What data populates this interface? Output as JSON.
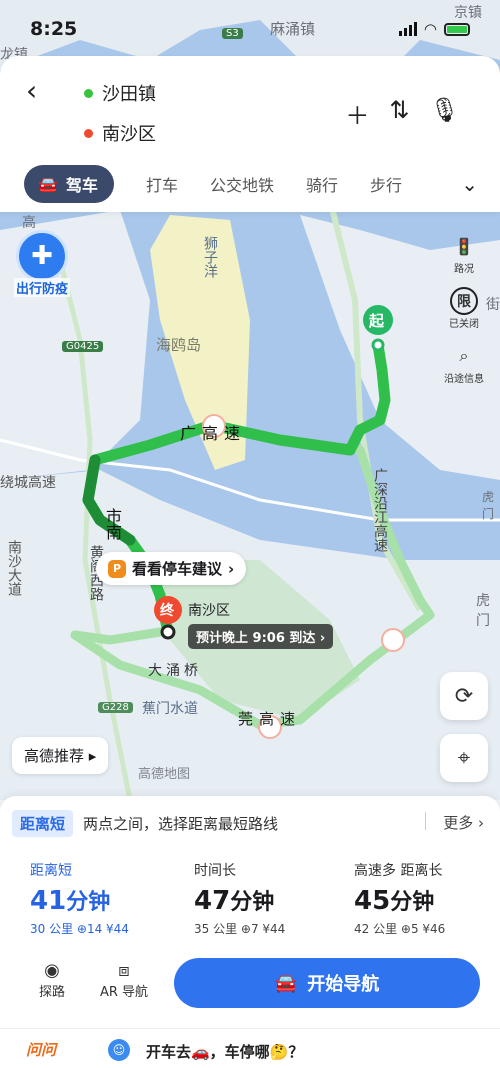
{
  "status": {
    "time": "8:25"
  },
  "map": {
    "labels": {
      "mayong": "麻涌镇",
      "longzhen": "龙镇",
      "jingzhen": "京镇",
      "s3": "S3",
      "shiziyang": "狮子洋",
      "haiouisland": "海鸥岛",
      "g0425": "G0425",
      "raocheng": "绕城高速",
      "nansha_ave": "南沙大道",
      "huangge": "黄阁西路",
      "dayongqiao": "大涌桥",
      "jiaomen": "蕉门水道",
      "g228": "G228",
      "guangshen_coast": "广深沿江高速",
      "huhu": "虎门",
      "humen2": "虎门",
      "jie": "街",
      "gaosu_guang": "广高速",
      "shi_nan": "市南",
      "guanhuang": "莞高速",
      "gao": "高"
    },
    "start_marker": "起",
    "end_marker": "终",
    "destination_label": "南沙区",
    "eta": "预计晚上 9:06 到达",
    "parking_tip": "看看停车建议",
    "recommend": "高德推荐",
    "logo": "高德地图",
    "epidemic": "出行防疫"
  },
  "header": {
    "origin": "沙田镇",
    "destination": "南沙区",
    "colors": {
      "origin": "#36c43c",
      "destination": "#ef4a2f"
    }
  },
  "modes": [
    {
      "label": "驾车",
      "active": true
    },
    {
      "label": "打车"
    },
    {
      "label": "公交地铁"
    },
    {
      "label": "骑行"
    },
    {
      "label": "步行"
    }
  ],
  "side_tools": {
    "traffic": "路况",
    "restrict": "已关闭",
    "restrict_icon": "限",
    "along": "沿途信息"
  },
  "sheet": {
    "tag": "距离短",
    "tip": "两点之间，选择距离最短路线",
    "more": "更多",
    "plans": [
      {
        "label": "距离短",
        "minutes": "41",
        "unit": "分钟",
        "detail": "30 公里  ⊕14  ¥44",
        "selected": true
      },
      {
        "label": "时间长",
        "minutes": "47",
        "unit": "分钟",
        "detail": "35 公里  ⊕7  ¥44"
      },
      {
        "label": "高速多  距离长",
        "minutes": "45",
        "unit": "分钟",
        "detail": "42 公里  ⊕5  ¥46"
      }
    ],
    "explore": "探路",
    "ar": "AR 导航",
    "start_nav": "开始导航"
  },
  "bottom": {
    "ask": "问问",
    "question": "开车去🚗，车停哪🤔？"
  },
  "colors": {
    "accent": "#2f73ef",
    "route": "#2fbf4a",
    "route_dark": "#1f8c36",
    "alt_route": "#a7e0a9"
  }
}
